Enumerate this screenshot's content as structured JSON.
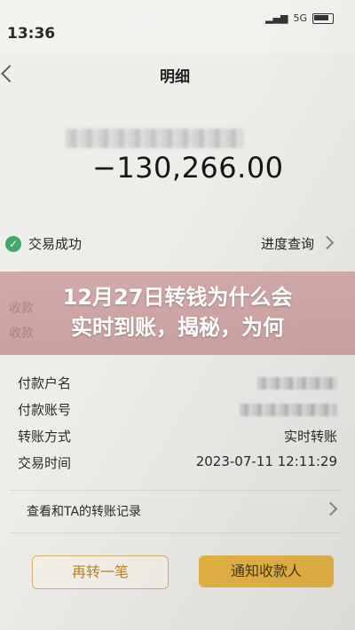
{
  "status_bar": {
    "time": "13:36",
    "network": "5G"
  },
  "nav": {
    "title": "明细"
  },
  "transaction": {
    "amount": "−130,266.00",
    "status": "交易成功",
    "progress_link": "进度查询"
  },
  "banner": {
    "line1": "12月27日转钱为什么会",
    "line2": "实时到账，揭秘，为何",
    "under_rows": [
      "收款",
      "收款"
    ]
  },
  "details": [
    {
      "label": "付款户名",
      "value": ""
    },
    {
      "label": "付款账号",
      "value": ""
    },
    {
      "label": "转账方式",
      "value": "实时转账"
    },
    {
      "label": "交易时间",
      "value": "2023-07-11 12:11:29"
    }
  ],
  "history_link": "查看和TA的转账记录",
  "buttons": {
    "transfer_again": "再转一笔",
    "notify_payee": "通知收款人"
  },
  "colors": {
    "success": "#3aa563",
    "accent": "#e8b646",
    "banner": "#c89696"
  }
}
